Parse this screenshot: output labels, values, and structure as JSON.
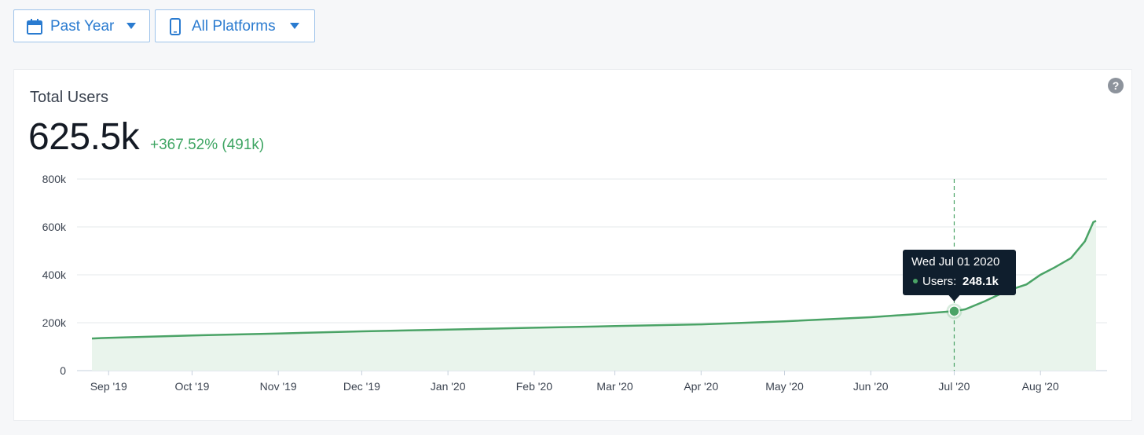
{
  "filters": {
    "date": {
      "label": "Past Year",
      "icon": "calendar-icon"
    },
    "platform": {
      "label": "All Platforms",
      "icon": "phone-icon"
    }
  },
  "card": {
    "title": "Total Users",
    "value": "625.5k",
    "change": "+367.52% (491k)",
    "help_label": "?"
  },
  "tooltip": {
    "date": "Wed Jul 01 2020",
    "label": "Users:",
    "value": "248.1k",
    "x": "2020-07-01",
    "y": 248100
  },
  "colors": {
    "accent": "#2a7bd0",
    "line": "#4aa366",
    "area": "#e9f4ec",
    "positive": "#3ea563"
  },
  "chart_data": {
    "type": "area",
    "ylim": [
      0,
      800000
    ],
    "yticks": [
      0,
      200000,
      400000,
      600000,
      800000
    ],
    "ytick_labels": [
      "0",
      "200k",
      "400k",
      "600k",
      "800k"
    ],
    "xlim": [
      "2020-08-21",
      "2020-08-21"
    ],
    "xticks": [
      "2019-09-01",
      "2019-10-01",
      "2019-11-01",
      "2019-12-01",
      "2020-01-01",
      "2020-02-01",
      "2020-03-01",
      "2020-04-01",
      "2020-05-01",
      "2020-06-01",
      "2020-07-01",
      "2020-08-01"
    ],
    "xtick_labels": [
      "Sep '19",
      "Oct '19",
      "Nov '19",
      "Dec '19",
      "Jan '20",
      "Feb '20",
      "Mar '20",
      "Apr '20",
      "May '20",
      "Jun '20",
      "Jul '20",
      "Aug '20"
    ],
    "grid": true,
    "series": [
      {
        "x": [
          "2019-08-26",
          "2019-09-01",
          "2019-10-01",
          "2019-11-01",
          "2019-12-01",
          "2020-01-01",
          "2020-02-01",
          "2020-03-01",
          "2020-04-01",
          "2020-05-01",
          "2020-06-01",
          "2020-06-15",
          "2020-07-01",
          "2020-07-05",
          "2020-07-12",
          "2020-07-20",
          "2020-07-27",
          "2020-08-01",
          "2020-08-06",
          "2020-08-12",
          "2020-08-17",
          "2020-08-20",
          "2020-08-21"
        ],
        "values": [
          134000,
          137000,
          147000,
          155000,
          164000,
          171000,
          179000,
          186000,
          193000,
          206000,
          223000,
          234000,
          248100,
          256000,
          290000,
          333000,
          360000,
          400000,
          430000,
          470000,
          540000,
          620000,
          625500
        ]
      }
    ]
  }
}
